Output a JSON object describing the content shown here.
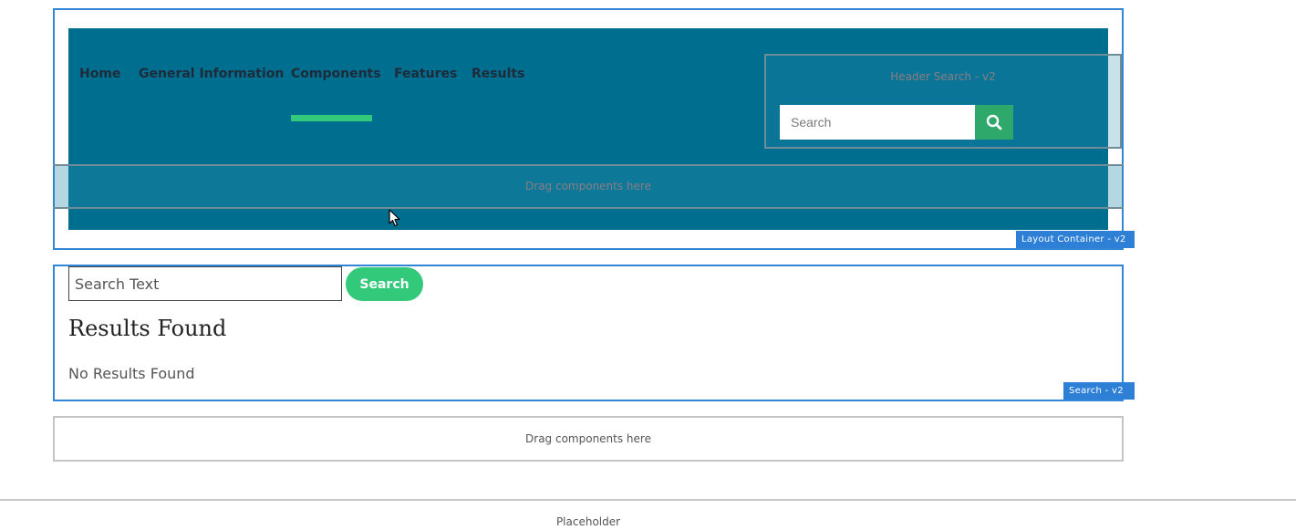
{
  "nav": {
    "items": [
      {
        "label": "Home"
      },
      {
        "label": "General Information"
      },
      {
        "label": "Components"
      },
      {
        "label": "Features"
      },
      {
        "label": "Results"
      }
    ],
    "active_index": 2
  },
  "header_search": {
    "label": "Header Search - v2",
    "placeholder": "Search",
    "button_icon": "search-icon"
  },
  "layout_container": {
    "dropzone_label": "Drag components here",
    "tag": "Layout Container - v2"
  },
  "search_component": {
    "input_placeholder": "Search Text",
    "button_label": "Search",
    "results_heading": "Results Found",
    "no_results_text": "No Results Found",
    "tag": "Search - v2"
  },
  "main_dropzone": {
    "label": "Drag components here"
  },
  "footer": {
    "placeholder_label": "Placeholder"
  },
  "colors": {
    "header_bg": "#006e8f",
    "accent_green": "#32c97a",
    "search_button_green": "#2fa96b",
    "editor_blue": "#2e7fd6"
  }
}
